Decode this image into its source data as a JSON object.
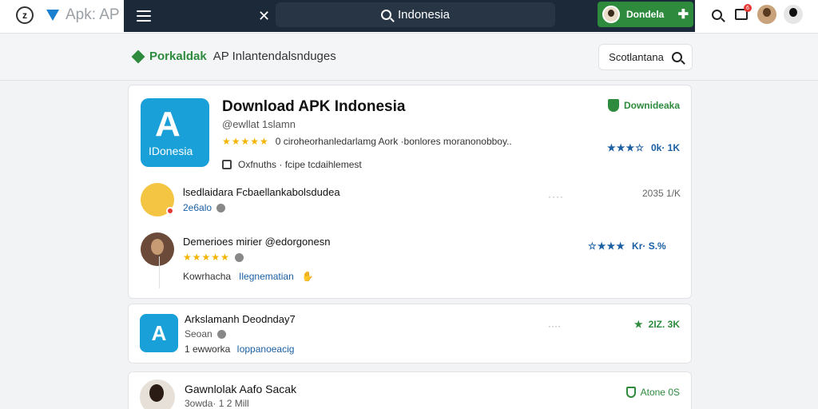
{
  "topbar": {
    "brand_text": "Apk: AP",
    "search_query": "Indonesia",
    "download_button": "Dondela",
    "notif_badge": "6"
  },
  "subbar": {
    "title": "Porkaldak",
    "subtitle": "AP Inlantendalsnduges",
    "sort_button": "Scotlantana"
  },
  "featured": {
    "icon_label": "IDonesia",
    "title": "Download APK Indonesia",
    "developer": "@ewllat 1slamn",
    "description": "0 ciroheorhanledarlamg Aork ·bonlores moranonobboy..",
    "meta": "Oxfnuths · fcipe tcdaihlemest",
    "verified": "Downideaka",
    "score": "0k· 1K",
    "reviews": [
      {
        "name": "lsedlaidara Fcbaellankabolsdudea",
        "sub": "2e6alo",
        "dots": "····",
        "right": "2035 1/K"
      },
      {
        "name": "Demerioes mirier @edorgonesn",
        "right": "Kr· S.%",
        "footer_left": "Kowrhacha",
        "footer_link": "Ilegnematian"
      }
    ]
  },
  "card2": {
    "title": "Arkslamanh Deodnday7",
    "sub": "Seoan",
    "foot_left": "1 ewworka",
    "foot_link": "Ioppanoeacig",
    "dots": "····",
    "right": "2IZ. 3K"
  },
  "card3": {
    "title": "Gawnlolak Aafo Sacak",
    "sub": "3owda· 1 2 Mill",
    "right": "Atone 0S"
  }
}
